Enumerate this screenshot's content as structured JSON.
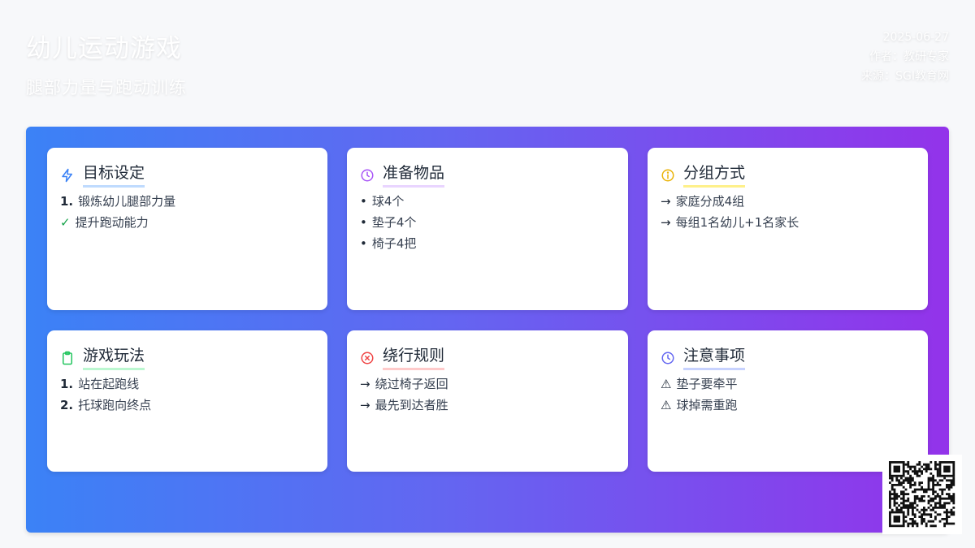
{
  "header": {
    "title": "幼儿运动游戏",
    "subtitle": "腿部力量与跑动训练",
    "date": "2025-06-27",
    "author": "作者：教研专家",
    "source": "来源：SGI教育网"
  },
  "cards": [
    {
      "title": "目标设定",
      "icon": "lightning-icon",
      "icon_color": "#3b82f6",
      "underline_color": "#bfdbfe",
      "items": [
        {
          "marker": "1.",
          "text": "锻炼幼儿腿部力量"
        },
        {
          "marker": "✓",
          "text": "提升跑动能力"
        }
      ]
    },
    {
      "title": "准备物品",
      "icon": "clock-icon",
      "icon_color": "#a855f7",
      "underline_color": "#e9d5ff",
      "items": [
        {
          "marker": "•",
          "text": "球4个"
        },
        {
          "marker": "•",
          "text": "垫子4个"
        },
        {
          "marker": "•",
          "text": "椅子4把"
        }
      ]
    },
    {
      "title": "分组方式",
      "icon": "info-icon",
      "icon_color": "#eab308",
      "underline_color": "#fef08a",
      "items": [
        {
          "marker": "→",
          "text": "家庭分成4组"
        },
        {
          "marker": "→",
          "text": "每组1名幼儿+1名家长"
        }
      ]
    },
    {
      "title": "游戏玩法",
      "icon": "clipboard-icon",
      "icon_color": "#22c55e",
      "underline_color": "#bbf7d0",
      "items": [
        {
          "marker": "1.",
          "text": "站在起跑线"
        },
        {
          "marker": "2.",
          "text": "托球跑向终点"
        }
      ]
    },
    {
      "title": "绕行规则",
      "icon": "x-circle-icon",
      "icon_color": "#ef4444",
      "underline_color": "#fecaca",
      "items": [
        {
          "marker": "→",
          "text": "绕过椅子返回"
        },
        {
          "marker": "→",
          "text": "最先到达者胜"
        }
      ]
    },
    {
      "title": "注意事项",
      "icon": "clock-icon",
      "icon_color": "#6366f1",
      "underline_color": "#c7d2fe",
      "items": [
        {
          "marker": "⚠",
          "text": "垫子要牵平"
        },
        {
          "marker": "⚠",
          "text": "球掉需重跑"
        }
      ]
    }
  ],
  "qr_code": {
    "icon": "qr-code-icon"
  }
}
